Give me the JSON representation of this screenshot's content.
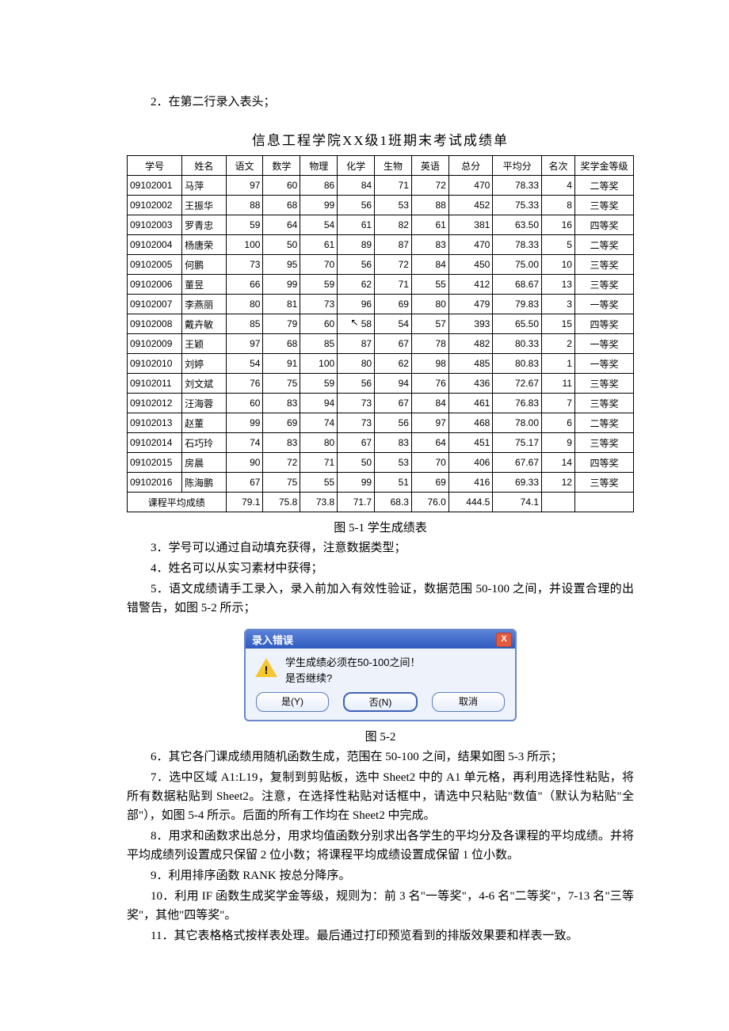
{
  "text": {
    "step2": "2．在第二行录入表头；",
    "table_title": "信息工程学院XX级1班期末考试成绩单",
    "caption_table": "图 5-1  学生成绩表",
    "step3": "3．学号可以通过自动填充获得，注意数据类型；",
    "step4": "4．姓名可以从实习素材中获得；",
    "step5": "5．语文成绩请手工录入，录入前加入有效性验证，数据范围 50-100 之间，并设置合理的出错警告，如图 5-2 所示；",
    "caption_dialog": "图 5-2",
    "step6": "6．其它各门课成绩用随机函数生成，范围在 50-100 之间，结果如图 5-3 所示；",
    "step7": "7．选中区域 A1:L19，复制到剪贴板，选中 Sheet2 中的 A1 单元格，再利用选择性粘贴，将所有数据粘贴到 Sheet2。注意，在选择性粘贴对话框中，请选中只粘贴\"数值\"（默认为粘贴\"全部\"），如图 5-4 所示。后面的所有工作均在 Sheet2 中完成。",
    "step8": "8．用求和函数求出总分，用求均值函数分别求出各学生的平均分及各课程的平均成绩。并将平均成绩列设置成只保留 2 位小数；将课程平均成绩设置成保留 1 位小数。",
    "step9": "9．利用排序函数 RANK 按总分降序。",
    "step10": "10．利用 IF 函数生成奖学金等级，规则为：前 3 名\"一等奖\"，4-6 名\"二等奖\"，7-13 名\"三等奖\"，其他\"四等奖\"。",
    "step11": "11．其它表格格式按样表处理。最后通过打印预览看到的排版效果要和样表一致。"
  },
  "dialog": {
    "title": "录入错误",
    "msg1": "学生成绩必须在50-100之间！",
    "msg2": "是否继续?",
    "btn_yes": "是(Y)",
    "btn_no": "否(N)",
    "btn_cancel": "取消",
    "close_x": "X"
  },
  "chart_data": {
    "type": "table",
    "headers": [
      "学号",
      "姓名",
      "语文",
      "数学",
      "物理",
      "化学",
      "生物",
      "英语",
      "总分",
      "平均分",
      "名次",
      "奖学金等级"
    ],
    "rows": [
      [
        "09102001",
        "马萍",
        97,
        60,
        86,
        84,
        71,
        72,
        470,
        "78.33",
        4,
        "二等奖"
      ],
      [
        "09102002",
        "王振华",
        88,
        68,
        99,
        56,
        53,
        88,
        452,
        "75.33",
        8,
        "三等奖"
      ],
      [
        "09102003",
        "罗青忠",
        59,
        64,
        54,
        61,
        82,
        61,
        381,
        "63.50",
        16,
        "四等奖"
      ],
      [
        "09102004",
        "杨唐荣",
        100,
        50,
        61,
        89,
        87,
        83,
        470,
        "78.33",
        5,
        "二等奖"
      ],
      [
        "09102005",
        "何鹏",
        73,
        95,
        70,
        56,
        72,
        84,
        450,
        "75.00",
        10,
        "三等奖"
      ],
      [
        "09102006",
        "董昱",
        66,
        99,
        59,
        62,
        71,
        55,
        412,
        "68.67",
        13,
        "三等奖"
      ],
      [
        "09102007",
        "李燕丽",
        80,
        81,
        73,
        96,
        69,
        80,
        479,
        "79.83",
        3,
        "一等奖"
      ],
      [
        "09102008",
        "戴卉敏",
        85,
        79,
        60,
        58,
        54,
        57,
        393,
        "65.50",
        15,
        "四等奖"
      ],
      [
        "09102009",
        "王颖",
        97,
        68,
        85,
        87,
        67,
        78,
        482,
        "80.33",
        2,
        "一等奖"
      ],
      [
        "09102010",
        "刘婷",
        54,
        91,
        100,
        80,
        62,
        98,
        485,
        "80.83",
        1,
        "一等奖"
      ],
      [
        "09102011",
        "刘文斌",
        76,
        75,
        59,
        56,
        94,
        76,
        436,
        "72.67",
        11,
        "三等奖"
      ],
      [
        "09102012",
        "汪海蓉",
        60,
        83,
        94,
        73,
        67,
        84,
        461,
        "76.83",
        7,
        "三等奖"
      ],
      [
        "09102013",
        "赵董",
        99,
        69,
        74,
        73,
        56,
        97,
        468,
        "78.00",
        6,
        "二等奖"
      ],
      [
        "09102014",
        "石巧玲",
        74,
        83,
        80,
        67,
        83,
        64,
        451,
        "75.17",
        9,
        "三等奖"
      ],
      [
        "09102015",
        "房晨",
        90,
        72,
        71,
        50,
        53,
        70,
        406,
        "67.67",
        14,
        "四等奖"
      ],
      [
        "09102016",
        "陈海鹏",
        67,
        75,
        55,
        99,
        51,
        69,
        416,
        "69.33",
        12,
        "三等奖"
      ]
    ],
    "footer_label": "课程平均成绩",
    "footer": [
      "79.1",
      "75.8",
      "73.8",
      "71.7",
      "68.3",
      "76.0",
      "444.5",
      "74.1"
    ],
    "cursor_cell": {
      "row_index": 7,
      "col_index": 5,
      "glyph": "↖"
    }
  }
}
